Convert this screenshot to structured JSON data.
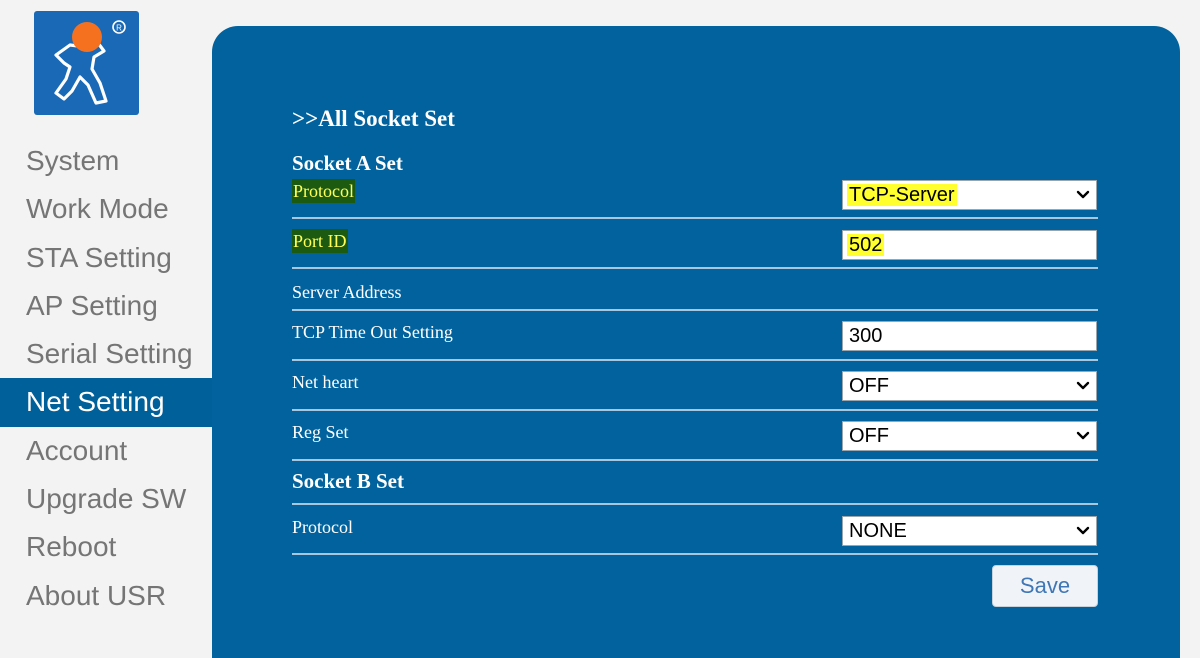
{
  "sidebar": {
    "items": [
      {
        "label": "System"
      },
      {
        "label": "Work Mode"
      },
      {
        "label": "STA Setting"
      },
      {
        "label": "AP Setting"
      },
      {
        "label": "Serial Setting"
      },
      {
        "label": "Net Setting",
        "active": true
      },
      {
        "label": "Account"
      },
      {
        "label": "Upgrade SW"
      },
      {
        "label": "Reboot"
      },
      {
        "label": "About USR"
      }
    ]
  },
  "logo": {
    "icon": "usr-person-logo-icon",
    "mark": "®"
  },
  "main": {
    "title": ">>All Socket Set",
    "socket_a": {
      "title": "Socket A Set",
      "protocol": {
        "label": "Protocol",
        "value": "TCP-Server"
      },
      "port_id": {
        "label": "Port ID",
        "value": "502"
      },
      "server_address": {
        "label": "Server Address"
      },
      "tcp_timeout": {
        "label": "TCP Time Out Setting",
        "value": "300"
      },
      "net_heart": {
        "label": "Net heart",
        "value": "OFF"
      },
      "reg_set": {
        "label": "Reg Set",
        "value": "OFF"
      }
    },
    "socket_b": {
      "title": "Socket B Set",
      "protocol": {
        "label": "Protocol",
        "value": "NONE"
      }
    },
    "save_label": "Save"
  },
  "colors": {
    "panel": "#01629d",
    "active_nav": "#00609a",
    "highlight_label_bg": "#1c5a12",
    "highlight_label_text": "#ffff5a",
    "highlight_value_bg": "#ffff2e"
  }
}
